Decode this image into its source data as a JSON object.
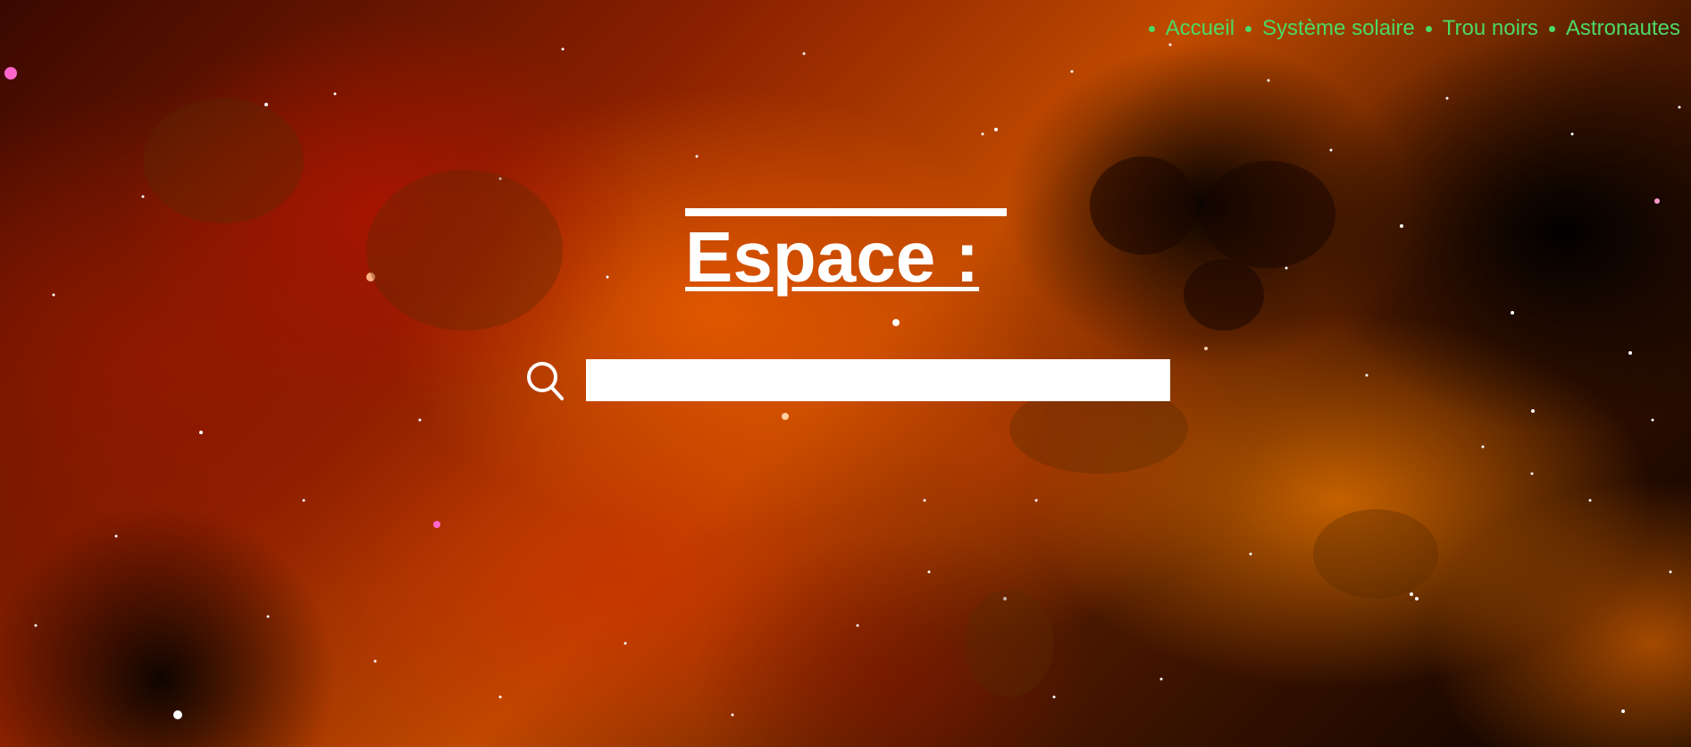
{
  "nav": {
    "items": [
      {
        "label": "Accueil"
      },
      {
        "label": "Système solaire"
      },
      {
        "label": "Trou noirs"
      },
      {
        "label": "Astronautes"
      }
    ],
    "color": "#4cd964"
  },
  "main": {
    "title": "Espace :"
  },
  "search": {
    "value": "",
    "placeholder": "",
    "icon": "search-icon"
  },
  "background": {
    "description_icon": "nebula-background"
  }
}
